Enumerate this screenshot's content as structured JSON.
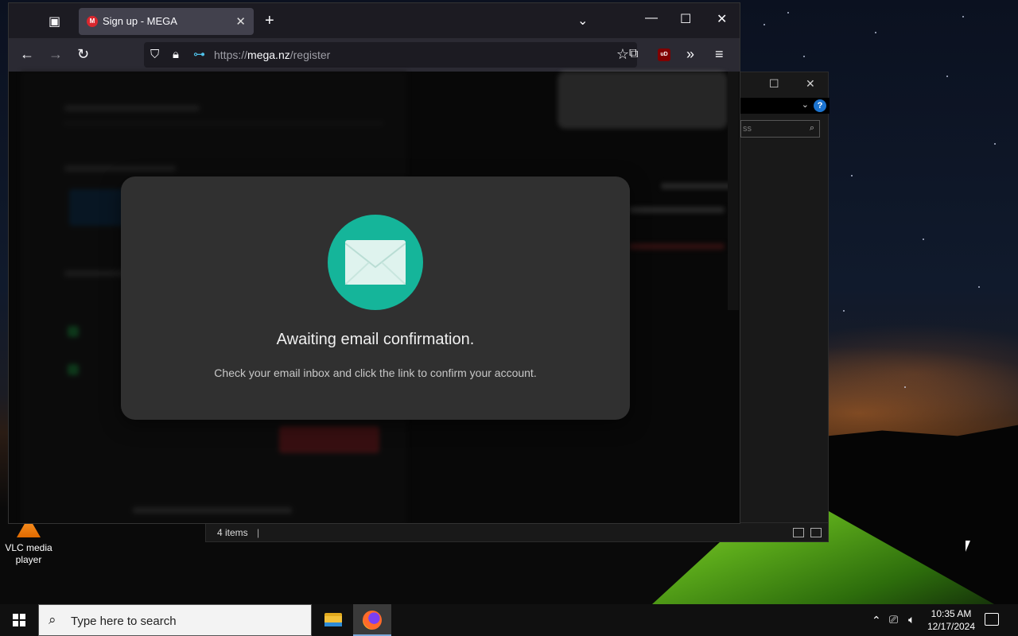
{
  "browser": {
    "tab_title": "Sign up - MEGA",
    "favicon_letter": "M",
    "url_prefix": "https://",
    "url_domain": "mega.nz",
    "url_path": "/register",
    "extension_badge": "uD"
  },
  "modal": {
    "title": "Awaiting email confirmation.",
    "message": "Check your email inbox and click the link to confirm your account.",
    "icon": "envelope-icon",
    "icon_color": "#15b59a"
  },
  "explorer": {
    "status_text": "4 items",
    "search_placeholder": "ss",
    "help_label": "?"
  },
  "desktop": {
    "icons": [
      {
        "label": "VLC media player"
      }
    ]
  },
  "taskbar": {
    "search_placeholder": "Type here to search",
    "time": "10:35 AM",
    "date": "12/17/2024"
  },
  "colors": {
    "accent": "#15b59a",
    "mega_red": "#d9272e"
  }
}
